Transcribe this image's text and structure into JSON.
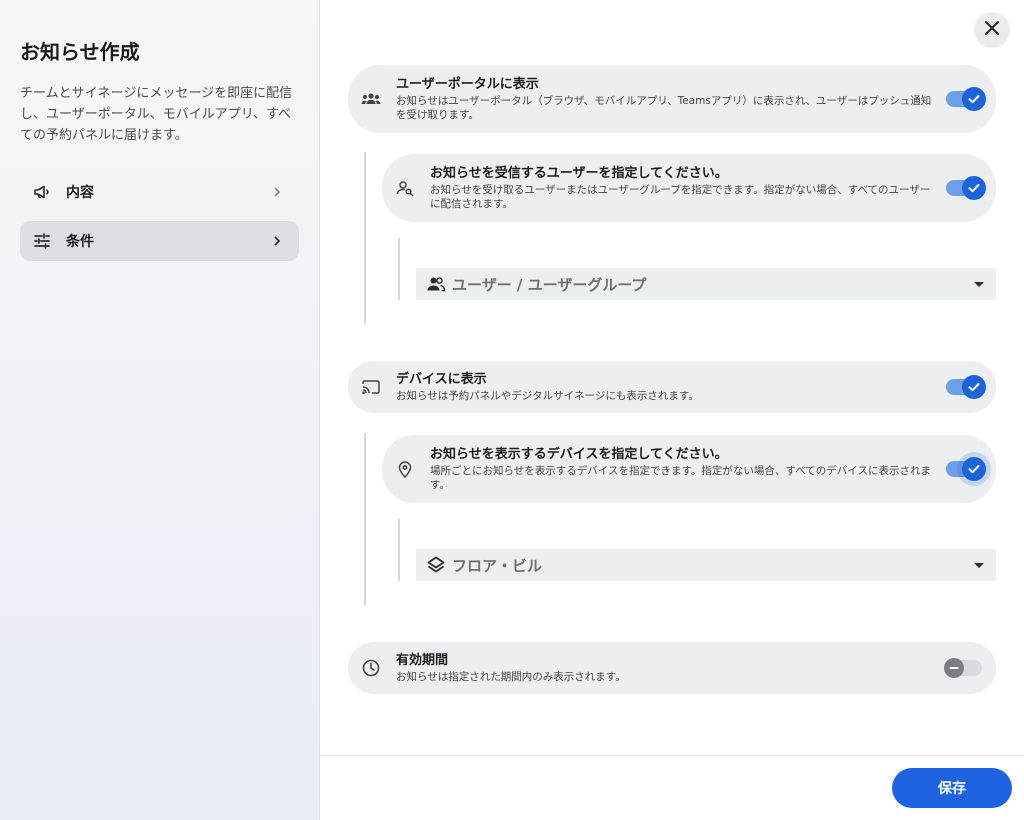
{
  "sidebar": {
    "title": "お知らせ作成",
    "description": "チームとサイネージにメッセージを即座に配信し、ユーザーポータル、モバイルアプリ、すべての予約パネルに届けます。",
    "items": [
      {
        "label": "内容",
        "icon": "megaphone-icon",
        "active": false
      },
      {
        "label": "条件",
        "icon": "tune-icon",
        "active": true
      }
    ]
  },
  "main": {
    "close_icon": "close-icon",
    "user_portal": {
      "title": "ユーザーポータルに表示",
      "description": "お知らせはユーザーポータル（ブラウザ、モバイルアプリ、Teamsアプリ）に表示され、ユーザーはプッシュ通知を受け取ります。",
      "enabled": true
    },
    "target_users": {
      "title": "お知らせを受信するユーザーを指定してください。",
      "description": "お知らせを受け取るユーザーまたはユーザーグループを指定できます。指定がない場合、すべてのユーザーに配信されます。",
      "enabled": true,
      "select_placeholder": "ユーザー / ユーザーグループ"
    },
    "devices": {
      "title": "デバイスに表示",
      "description": "お知らせは予約パネルやデジタルサイネージにも表示されます。",
      "enabled": true
    },
    "target_devices": {
      "title": "お知らせを表示するデバイスを指定してください。",
      "description": "場所ごとにお知らせを表示するデバイスを指定できます。指定がない場合、すべてのデバイスに表示されます。",
      "enabled": true,
      "select_placeholder": "フロア・ビル"
    },
    "validity": {
      "title": "有効期間",
      "description": "お知らせは指定された期間内のみ表示されます。",
      "enabled": false
    },
    "save_label": "保存"
  },
  "colors": {
    "accent": "#1f63e0",
    "toggle_track_on": "#6f9fe6",
    "card_bg": "#eceef2"
  }
}
